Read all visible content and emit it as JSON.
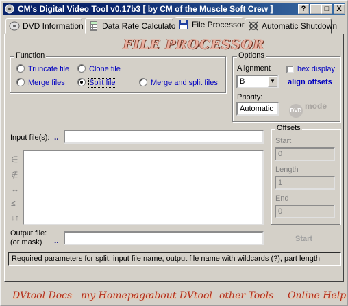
{
  "window": {
    "title": "CM's Digital Video Tool v0.17b3  [ by CM of the Muscle Soft Crew ]",
    "buttons": [
      "?",
      "_",
      "□",
      "X"
    ]
  },
  "tabs": [
    {
      "label": "DVD Information",
      "icon": "dvd-icon"
    },
    {
      "label": "Data Rate Calculator",
      "icon": "calculator-icon"
    },
    {
      "label": "File Processor",
      "icon": "floppy-icon",
      "active": true
    },
    {
      "label": "Automatic Shutdown",
      "icon": "shutdown-icon"
    }
  ],
  "panel_title": "FILE PROCESSOR",
  "function": {
    "label": "Function",
    "options": {
      "truncate": "Truncate file",
      "clone": "Clone file",
      "merge": "Merge files",
      "split": "Split file",
      "merge_split": "Merge and split files"
    },
    "selected": "split"
  },
  "options": {
    "label": "Options",
    "alignment_label": "Alignment",
    "alignment_value": "B",
    "hex_display": "hex display",
    "align_offsets": "align offsets",
    "priority_label": "Priority:",
    "priority_value": "Automatic",
    "dvd_mode": "mode",
    "dvd_logo": "DVD"
  },
  "input": {
    "label": "Input file(s):",
    "dots": "..",
    "value": ""
  },
  "side_icons": [
    "∈",
    "∉",
    "↔",
    "≤",
    "↓↑"
  ],
  "offsets": {
    "label": "Offsets",
    "start_label": "Start",
    "start_value": "0",
    "length_label": "Length",
    "length_value": "1",
    "end_label": "End",
    "end_value": "0"
  },
  "output": {
    "label_line1": "Output file:",
    "label_line2": "(or mask)",
    "dots": "..",
    "value": ""
  },
  "start_button": "Start",
  "status": "Required parameters for split: input file name, output file name with wildcards (?), part length",
  "links": [
    "DVtool Docs",
    "my Homepage",
    "about DVtool",
    "other Tools",
    "Online Help"
  ]
}
